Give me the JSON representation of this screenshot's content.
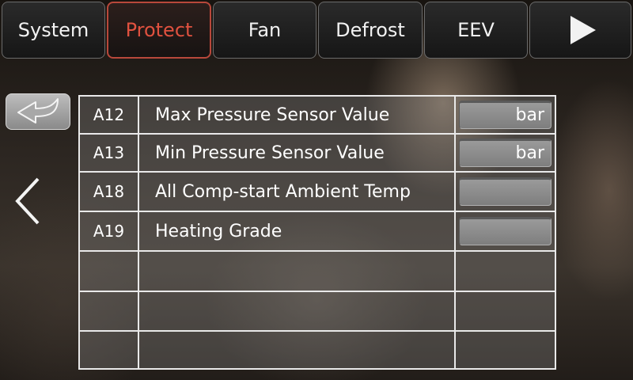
{
  "tabs": [
    {
      "label": "System",
      "active": false
    },
    {
      "label": "Protect",
      "active": true
    },
    {
      "label": "Fan",
      "active": false
    },
    {
      "label": "Defrost",
      "active": false
    },
    {
      "label": "EEV",
      "active": false
    }
  ],
  "icons": {
    "next": "play-triangle-icon",
    "back": "return-arrow-icon",
    "prev": "chevron-left-icon"
  },
  "colors": {
    "active_tab": "#e0513f",
    "text": "#ffffff",
    "grid_line": "#e9e9e9"
  },
  "params": [
    {
      "code": "A12",
      "name": "Max Pressure Sensor Value",
      "value": "",
      "unit": "bar"
    },
    {
      "code": "A13",
      "name": "Min Pressure Sensor Value",
      "value": "",
      "unit": "bar"
    },
    {
      "code": "A18",
      "name": "All Comp-start Ambient Temp",
      "value": "",
      "unit": ""
    },
    {
      "code": "A19",
      "name": "Heating Grade",
      "value": "",
      "unit": ""
    }
  ]
}
